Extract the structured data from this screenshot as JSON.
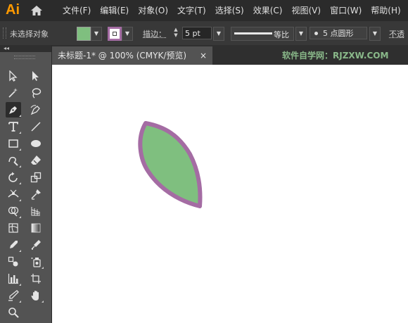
{
  "app": {
    "logo": "Ai"
  },
  "menu": [
    "文件(F)",
    "编辑(E)",
    "对象(O)",
    "文字(T)",
    "选择(S)",
    "效果(C)",
    "视图(V)",
    "窗口(W)",
    "帮助(H)"
  ],
  "control_bar": {
    "selection_status": "未选择对象",
    "fill_color": "#7fbf7f",
    "stroke_color": "#a46ca3",
    "stroke_label": "描边：",
    "stroke_weight": "5 pt",
    "stroke_profile": "等比",
    "brush": "5 点圆形",
    "opacity_label": "不透"
  },
  "toolbar": {
    "collapse_glyph": "◂◂",
    "tools": [
      {
        "icon": "selection-tool-icon"
      },
      {
        "icon": "direct-selection-tool-icon"
      },
      {
        "icon": "magic-wand-tool-icon"
      },
      {
        "icon": "lasso-tool-icon"
      },
      {
        "icon": "pen-tool-icon",
        "active": true
      },
      {
        "icon": "curvature-tool-icon"
      },
      {
        "icon": "type-tool-icon"
      },
      {
        "icon": "line-segment-tool-icon"
      },
      {
        "icon": "rectangle-tool-icon"
      },
      {
        "icon": "ellipse-tool-icon"
      },
      {
        "icon": "shaper-tool-icon"
      },
      {
        "icon": "eraser-tool-icon"
      },
      {
        "icon": "rotate-tool-icon"
      },
      {
        "icon": "scale-tool-icon"
      },
      {
        "icon": "width-tool-icon"
      },
      {
        "icon": "puppet-warp-tool-icon"
      },
      {
        "icon": "shape-builder-tool-icon"
      },
      {
        "icon": "perspective-grid-tool-icon"
      },
      {
        "icon": "mesh-tool-icon"
      },
      {
        "icon": "gradient-tool-icon"
      },
      {
        "icon": "eyedropper-tool-icon"
      },
      {
        "icon": "measure-tool-icon"
      },
      {
        "icon": "blend-tool-icon"
      },
      {
        "icon": "symbol-sprayer-tool-icon"
      },
      {
        "icon": "column-graph-tool-icon"
      },
      {
        "icon": "artboard-tool-icon"
      },
      {
        "icon": "slice-tool-icon"
      },
      {
        "icon": "hand-tool-icon"
      },
      {
        "icon": "zoom-tool-icon"
      }
    ]
  },
  "document": {
    "tab_title": "未标题-1* @ 100% (CMYK/预览)",
    "close_glyph": "×",
    "watermark": "软件自学网：RJZXW.COM"
  },
  "canvas": {
    "shape": "leaf",
    "fill_color": "#7fbf7f",
    "stroke_color": "#a46ca3"
  }
}
